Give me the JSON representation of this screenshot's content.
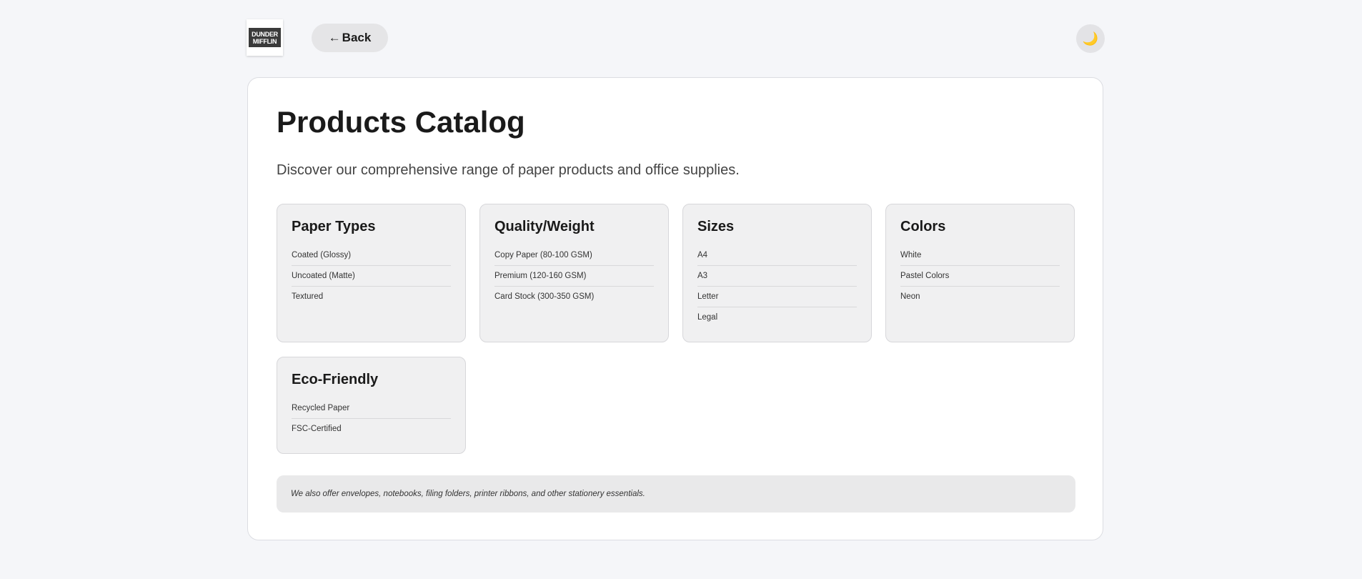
{
  "header": {
    "logo_line1": "DUNDER",
    "logo_line2": "MIFFLIN",
    "back_label": "Back",
    "back_arrow": "←",
    "theme_icon": "🌙"
  },
  "main": {
    "title": "Products Catalog",
    "subtitle": "Discover our comprehensive range of paper products and office supplies.",
    "categories": [
      {
        "title": "Paper Types",
        "items": [
          "Coated (Glossy)",
          "Uncoated (Matte)",
          "Textured"
        ]
      },
      {
        "title": "Quality/Weight",
        "items": [
          "Copy Paper (80-100 GSM)",
          "Premium (120-160 GSM)",
          "Card Stock (300-350 GSM)"
        ]
      },
      {
        "title": "Sizes",
        "items": [
          "A4",
          "A3",
          "Letter",
          "Legal"
        ]
      },
      {
        "title": "Colors",
        "items": [
          "White",
          "Pastel Colors",
          "Neon"
        ]
      },
      {
        "title": "Eco-Friendly",
        "items": [
          "Recycled Paper",
          "FSC-Certified"
        ]
      }
    ],
    "note": "We also offer envelopes, notebooks, filing folders, printer ribbons, and other stationery essentials."
  },
  "colors": {
    "page_bg": "#f5f6f9",
    "card_bg": "#ffffff",
    "category_bg": "#f0f0f1",
    "note_bg": "#e9e9ea",
    "text": "#1a1a1a"
  }
}
